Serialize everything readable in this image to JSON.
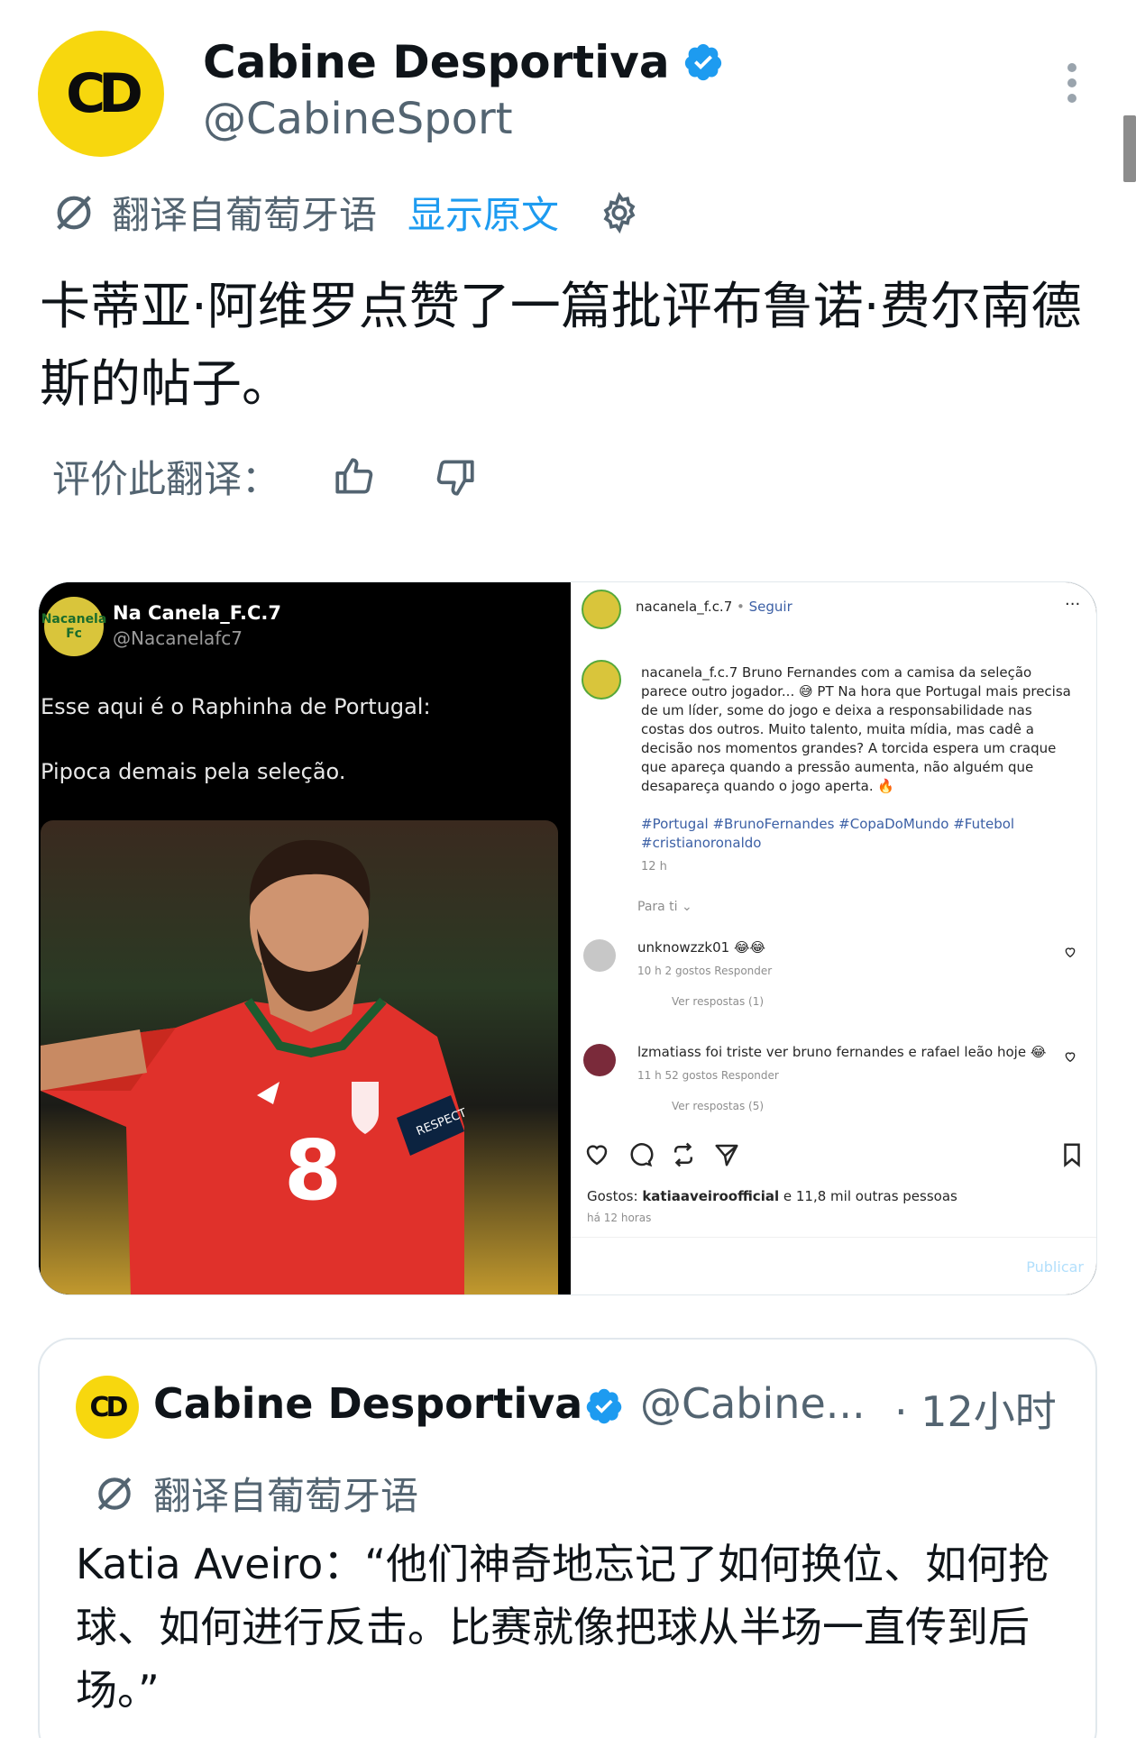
{
  "header": {
    "display_name": "Cabine Desportiva",
    "handle": "@CabineSport",
    "avatar_text": "CD"
  },
  "translation_bar": {
    "label": "翻译自葡萄牙语",
    "show_original": "显示原文"
  },
  "tweet": {
    "text": "卡蒂亚·阿维罗点赞了一篇批评布鲁诺·费尔南德斯的帖子。"
  },
  "rating": {
    "label": "评价此翻译："
  },
  "media": {
    "left": {
      "avatar_text": "Nacanela Fc",
      "name": "Na Canela_F.C.7",
      "handle": "@Nacanelafc7",
      "line1": "Esse aqui é o Raphinha de Portugal:",
      "line2": "Pipoca demais pela seleção.",
      "shirt_number": "8",
      "armband": "RESPECT"
    },
    "right": {
      "username": "nacanela_f.c.7",
      "follow": "Seguir",
      "more": "···",
      "caption_user": "nacanela_f.c.7",
      "caption": "Bruno Fernandes com a camisa da seleção parece outro jogador... 😅 PT Na hora que Portugal mais precisa de um líder, some do jogo e deixa a responsabilidade nas costas dos outros. Muito talento, muita mídia, mas cadê a decisão nos momentos grandes? A torcida espera um craque que apareça quando a pressão aumenta, não alguém que desapareça quando o jogo aperta. 🔥",
      "tags": "#Portugal #BrunoFernandes #CopaDoMundo #Futebol #cristianoronaldo",
      "time": "12 h",
      "for_you": "Para ti ⌄",
      "comments": [
        {
          "user": "unknowzzk01",
          "text": "😂😂",
          "meta": "10 h   2 gostos   Responder",
          "replies": "Ver respostas (1)"
        },
        {
          "user": "lzmatiass",
          "text": "foi triste ver bruno fernandes e rafael leão hoje 😂",
          "meta": "11 h   52 gostos   Responder",
          "replies": "Ver respostas (5)"
        }
      ],
      "likes_prefix": "Gostos:",
      "likes_user": "katiaaveiroofficial",
      "likes_suffix": "e 11,8 mil outras pessoas",
      "ago": "há 12 horas",
      "publish": "Publicar"
    }
  },
  "quote": {
    "avatar_text": "CD",
    "display_name": "Cabine Desportiva",
    "handle": "@Cabine...",
    "time": "· 12小时",
    "translate_label": "翻译自葡萄牙语",
    "text": "Katia Aveiro：“他们神奇地忘记了如何换位、如何抢球、如何进行反击。比赛就像把球从半场一直传到后场。”"
  },
  "colors": {
    "brand_yellow": "#f7d70e",
    "link_blue": "#1d9bf0",
    "text_primary": "#0f1419",
    "text_secondary": "#536471",
    "shirt_red": "#e0312b"
  },
  "icons": {
    "verified": "verified-badge-icon",
    "translate": "translate-icon",
    "settings": "gear-icon",
    "thumbs_up": "thumbs-up-icon",
    "thumbs_down": "thumbs-down-icon",
    "more": "more-vertical-icon"
  }
}
